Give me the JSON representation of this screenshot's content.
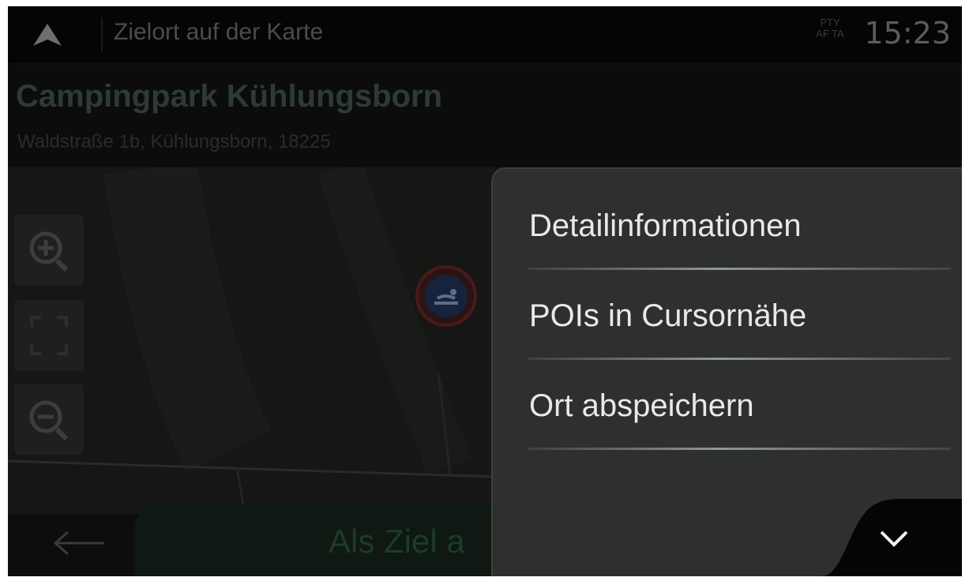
{
  "topbar": {
    "title": "Zielort auf der Karte",
    "rds_line1": "PTY",
    "rds_line2": "AF TA",
    "time": "15:23",
    "icons": [
      "navigation-arrow-icon"
    ]
  },
  "location": {
    "name": "Campingpark Kühlungsborn",
    "address": "Waldstraße 1b, Kühlungsborn, 18225"
  },
  "map_controls": {
    "icons": [
      "zoom-in-icon",
      "fit-view-icon",
      "zoom-out-icon"
    ],
    "poi_icon": "camping-poi-icon"
  },
  "menu": {
    "items": [
      {
        "label": "Detailinformationen"
      },
      {
        "label": "POIs in Cursornähe"
      },
      {
        "label": "Ort abspeichern"
      }
    ]
  },
  "bottombar": {
    "go_label": "Als Ziel a",
    "icons": [
      "back-arrow-icon",
      "chevron-down-icon"
    ]
  },
  "colors": {
    "menu_bg": "#2e302e",
    "menu_text": "#e8e9e8",
    "go_button": "#0f1812"
  }
}
